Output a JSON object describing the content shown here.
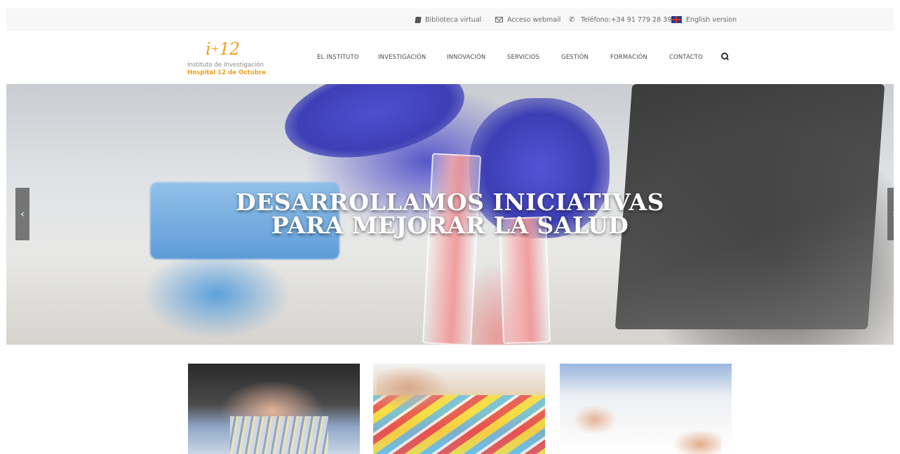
{
  "topbar": {
    "links": [
      {
        "label": "Biblioteca virtual",
        "icon": "book-icon"
      },
      {
        "label": "Acceso webmail",
        "icon": "mail-icon"
      },
      {
        "label": "Teléfono:+34 91 779 28 39",
        "icon": "phone-icon"
      },
      {
        "label": "English version",
        "icon": "uk-flag-icon"
      }
    ]
  },
  "logo": {
    "mark_i": "i",
    "mark_plus": "+",
    "mark_12": "12",
    "line1": "Instituto de Investigación",
    "line2": "Hospital 12 de Octubre"
  },
  "nav": {
    "items": [
      "EL INSTITUTO",
      "INVESTIGACIÓN",
      "INNOVACIÓN",
      "SERVICIOS",
      "GESTIÓN",
      "FORMACIÓN",
      "CONTACTO"
    ],
    "search_icon": "search-icon"
  },
  "hero": {
    "line1": "DESARROLLAMOS INICIATIVAS",
    "line2": "PARA MEJORAR LA SALUD",
    "prev_symbol": "‹",
    "next_symbol": "›"
  },
  "colors": {
    "brand_orange": "#f0a01c",
    "topbar_bg": "#f7f7f7",
    "nav_text": "#4a4a4a"
  }
}
